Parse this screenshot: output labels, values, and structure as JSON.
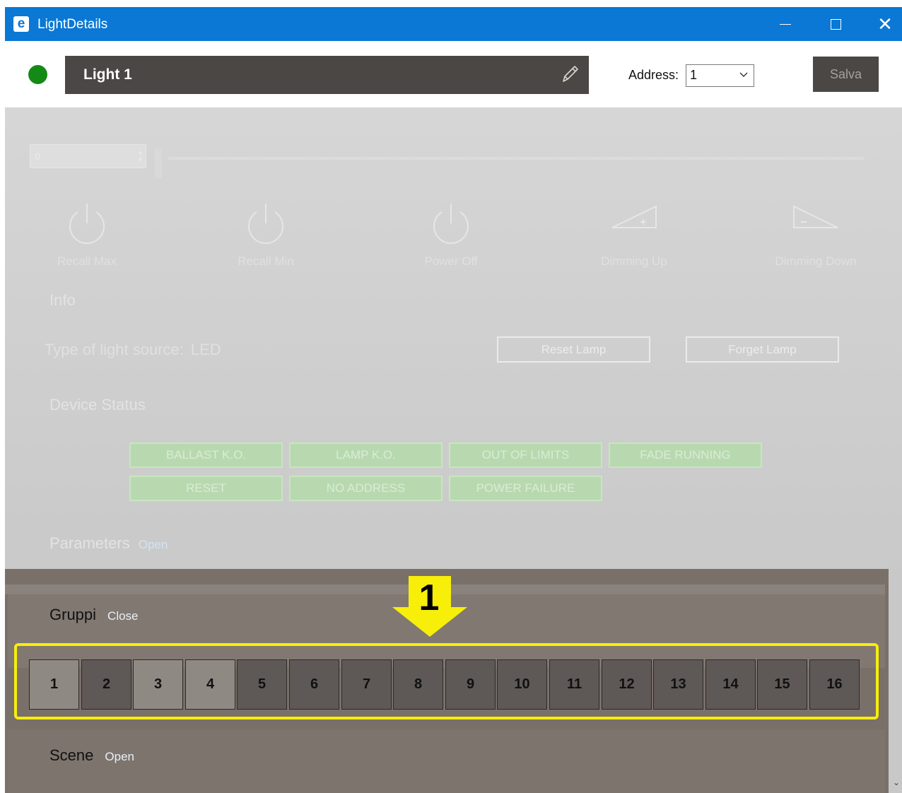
{
  "window": {
    "title": "LightDetails",
    "app_icon_letter": "e",
    "controls": {
      "minimize": "—",
      "maximize": "☐",
      "close": "✕"
    }
  },
  "header": {
    "status_color": "#138a16",
    "light_name": "Light 1",
    "address_label": "Address:",
    "address_value": "1",
    "save_label": "Salva"
  },
  "dimmer": {
    "level_value": "0"
  },
  "commands": [
    {
      "label": "Recall Max",
      "icon": "power-icon"
    },
    {
      "label": "Recall Min",
      "icon": "power-icon"
    },
    {
      "label": "Power Off",
      "icon": "power-icon"
    },
    {
      "label": "Dimming Up",
      "icon": "dimming-up-icon"
    },
    {
      "label": "Dimming Down",
      "icon": "dimming-down-icon"
    }
  ],
  "info": {
    "title": "Info",
    "light_source_label": "Type of light source:",
    "light_source_value": "LED",
    "reset_lamp": "Reset Lamp",
    "forget_lamp": "Forget Lamp"
  },
  "device_status": {
    "title": "Device Status",
    "flags": [
      "BALLAST K.O.",
      "LAMP K.O.",
      "OUT OF LIMITS",
      "FADE RUNNING",
      "RESET",
      "NO ADDRESS",
      "POWER FAILURE"
    ]
  },
  "parameters": {
    "title": "Parameters",
    "toggle": "Open"
  },
  "groups": {
    "title": "Gruppi",
    "toggle": "Close",
    "callout_number": "1",
    "items": [
      {
        "label": "1",
        "selected": true
      },
      {
        "label": "2",
        "selected": false
      },
      {
        "label": "3",
        "selected": true
      },
      {
        "label": "4",
        "selected": true
      },
      {
        "label": "5",
        "selected": false
      },
      {
        "label": "6",
        "selected": false
      },
      {
        "label": "7",
        "selected": false
      },
      {
        "label": "8",
        "selected": false
      },
      {
        "label": "9",
        "selected": false
      },
      {
        "label": "10",
        "selected": false
      },
      {
        "label": "11",
        "selected": false
      },
      {
        "label": "12",
        "selected": false
      },
      {
        "label": "13",
        "selected": false
      },
      {
        "label": "14",
        "selected": false
      },
      {
        "label": "15",
        "selected": false
      },
      {
        "label": "16",
        "selected": false
      }
    ],
    "highlight_color": "#f7ee0a"
  },
  "scene": {
    "title": "Scene",
    "toggle": "Open"
  }
}
